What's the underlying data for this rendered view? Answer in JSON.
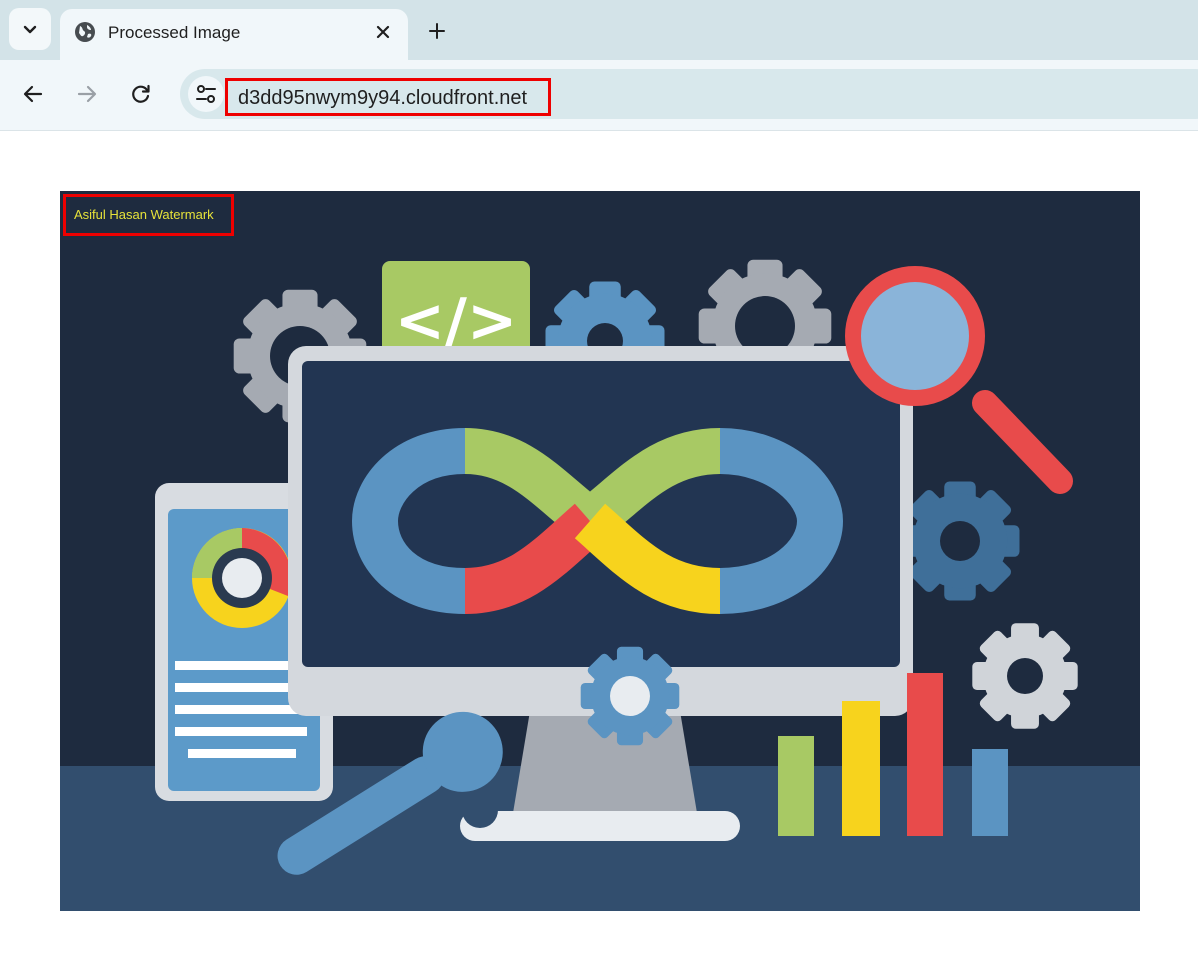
{
  "browser": {
    "tab": {
      "title": "Processed Image"
    },
    "address_bar": {
      "url": "d3dd95nwym9y94.cloudfront.net"
    }
  },
  "page": {
    "image": {
      "watermark": "Asiful Hasan Watermark"
    }
  },
  "colors": {
    "highlight": "#ee0000",
    "watermark": "#e6e23a",
    "background": "#1e2b3f"
  },
  "icons": [
    "chevron-down-icon",
    "globe-icon",
    "close-icon",
    "plus-icon",
    "back-arrow-icon",
    "forward-arrow-icon",
    "reload-icon",
    "site-info-icon"
  ]
}
